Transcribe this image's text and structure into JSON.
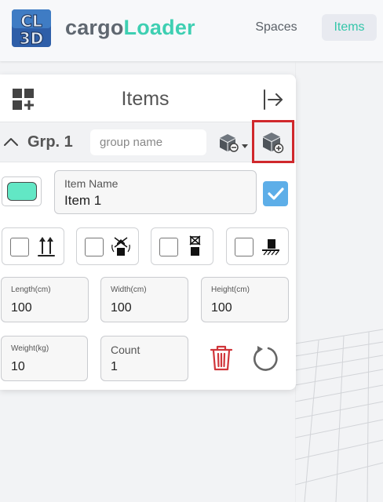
{
  "app": {
    "logo_text": "CL3D",
    "brand_part1": "cargo",
    "brand_part2": "Loader"
  },
  "nav": [
    {
      "label": "Spaces",
      "active": false
    },
    {
      "label": "Items",
      "active": true
    }
  ],
  "panel": {
    "title": "Items",
    "group": {
      "label": "Grp. 1",
      "name_placeholder": "group name",
      "name_value": ""
    },
    "item": {
      "color": "#62e7c5",
      "name_label": "Item Name",
      "name_value": "Item 1",
      "enabled": true
    },
    "options": [
      {
        "icon": "this-side-up-icon",
        "checked": false
      },
      {
        "icon": "no-tilt-icon",
        "checked": false
      },
      {
        "icon": "no-stack-icon",
        "checked": false
      },
      {
        "icon": "bottom-only-icon",
        "checked": false
      }
    ],
    "dimensions": {
      "length": {
        "label": "Length(cm)",
        "value": "100"
      },
      "width": {
        "label": "Width(cm)",
        "value": "100"
      },
      "height": {
        "label": "Height(cm)",
        "value": "100"
      }
    },
    "weight": {
      "label": "Weight(kg)",
      "value": "10"
    },
    "count": {
      "label": "Count",
      "value": "1"
    }
  },
  "colors": {
    "accent": "#3ecfb2",
    "highlight_border": "#d0282c",
    "delete": "#d0353a",
    "check": "#5daee8"
  }
}
